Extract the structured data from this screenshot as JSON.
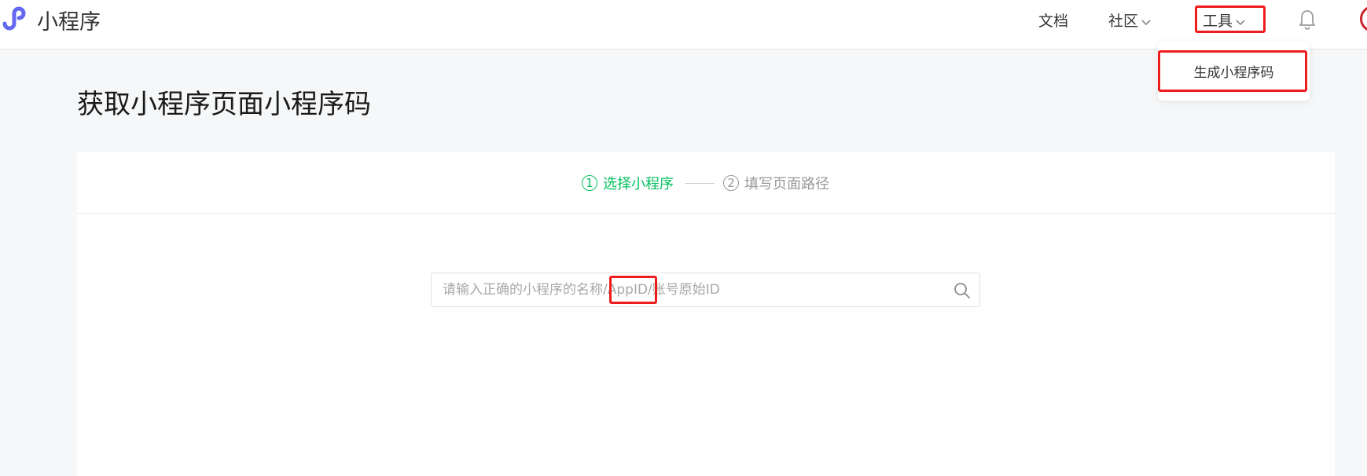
{
  "header": {
    "brand": "小程序",
    "nav": {
      "docs": "文档",
      "community": "社区",
      "tools": "工具"
    },
    "icons": [
      "miniprogram-logo-icon",
      "chevron-down-icon",
      "bell-icon",
      "avatar"
    ]
  },
  "tools_menu": {
    "items": [
      "生成小程序码"
    ]
  },
  "main": {
    "title": "获取小程序页面小程序码",
    "steps": [
      {
        "number": "1",
        "label": "选择小程序",
        "state": "active"
      },
      {
        "number": "2",
        "label": "填写页面路径",
        "state": "inactive"
      }
    ],
    "search": {
      "placeholder": "请输入正确的小程序的名称/AppID/账号原始ID",
      "value": ""
    }
  },
  "colors": {
    "accent": "#07c160",
    "highlight": "#ee1c1c",
    "logo": "#6467f0",
    "background": "#f6f7f8"
  }
}
